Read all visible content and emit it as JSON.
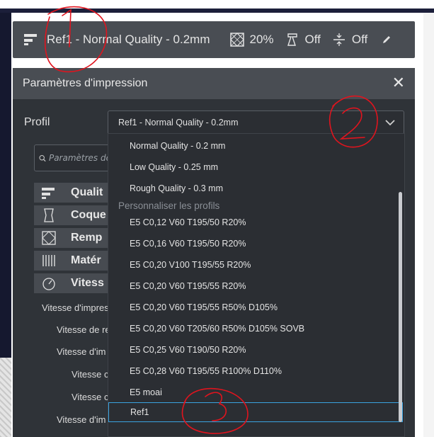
{
  "topbar": {
    "profile": "Ref1 - Normal Quality - 0.2mm",
    "infill": "20%",
    "support": "Off",
    "adhesion": "Off"
  },
  "panel": {
    "title": "Paramètres d'impression",
    "profile_label": "Profil",
    "profile_value": "Ref1 - Normal Quality - 0.2mm",
    "search_placeholder": "Paramètres de"
  },
  "categories": [
    {
      "label": "Qualit",
      "icon": "quality-icon"
    },
    {
      "label": "Coque",
      "icon": "shell-icon"
    },
    {
      "label": "Remp",
      "icon": "infill-icon"
    },
    {
      "label": "Matér",
      "icon": "material-icon"
    },
    {
      "label": "Vitess",
      "icon": "speed-icon"
    }
  ],
  "settings": [
    "Vitesse d'impres",
    "Vitesse de re",
    "Vitesse d'im",
    "Vitesse c",
    "Vitesse c",
    "Vitesse d'im"
  ],
  "dropdown": {
    "items_top": [
      "Normal Quality - 0.2 mm",
      "Low Quality - 0.25 mm",
      "Rough Quality - 0.3 mm"
    ],
    "custom_header": "Personnaliser les profils",
    "custom_items": [
      "E5 C0,12 V60 T195/50 R20%",
      "E5 C0,16 V60 T195/50 R20%",
      "E5 C0,20 V100 T195/55 R20%",
      "E5 C0,20 V60 T195/55 R20%",
      "E5 C0,20 V60 T195/55 R50% D105%",
      "E5 C0,20 V60 T205/60 R50% D105% SOVB",
      "E5 C0,25 V60 T190/50 R20%",
      "E5 C0,28 V60 T195/55 R100% D110%",
      "E5 moai",
      "Ref1"
    ],
    "selected": "Ref1"
  },
  "annotations": {
    "color": "#e0141e",
    "labels": [
      "1",
      "2",
      "3"
    ]
  },
  "colors": {
    "panel": "#2f3338",
    "header": "#494d53",
    "accent": "#3aa3e0"
  }
}
